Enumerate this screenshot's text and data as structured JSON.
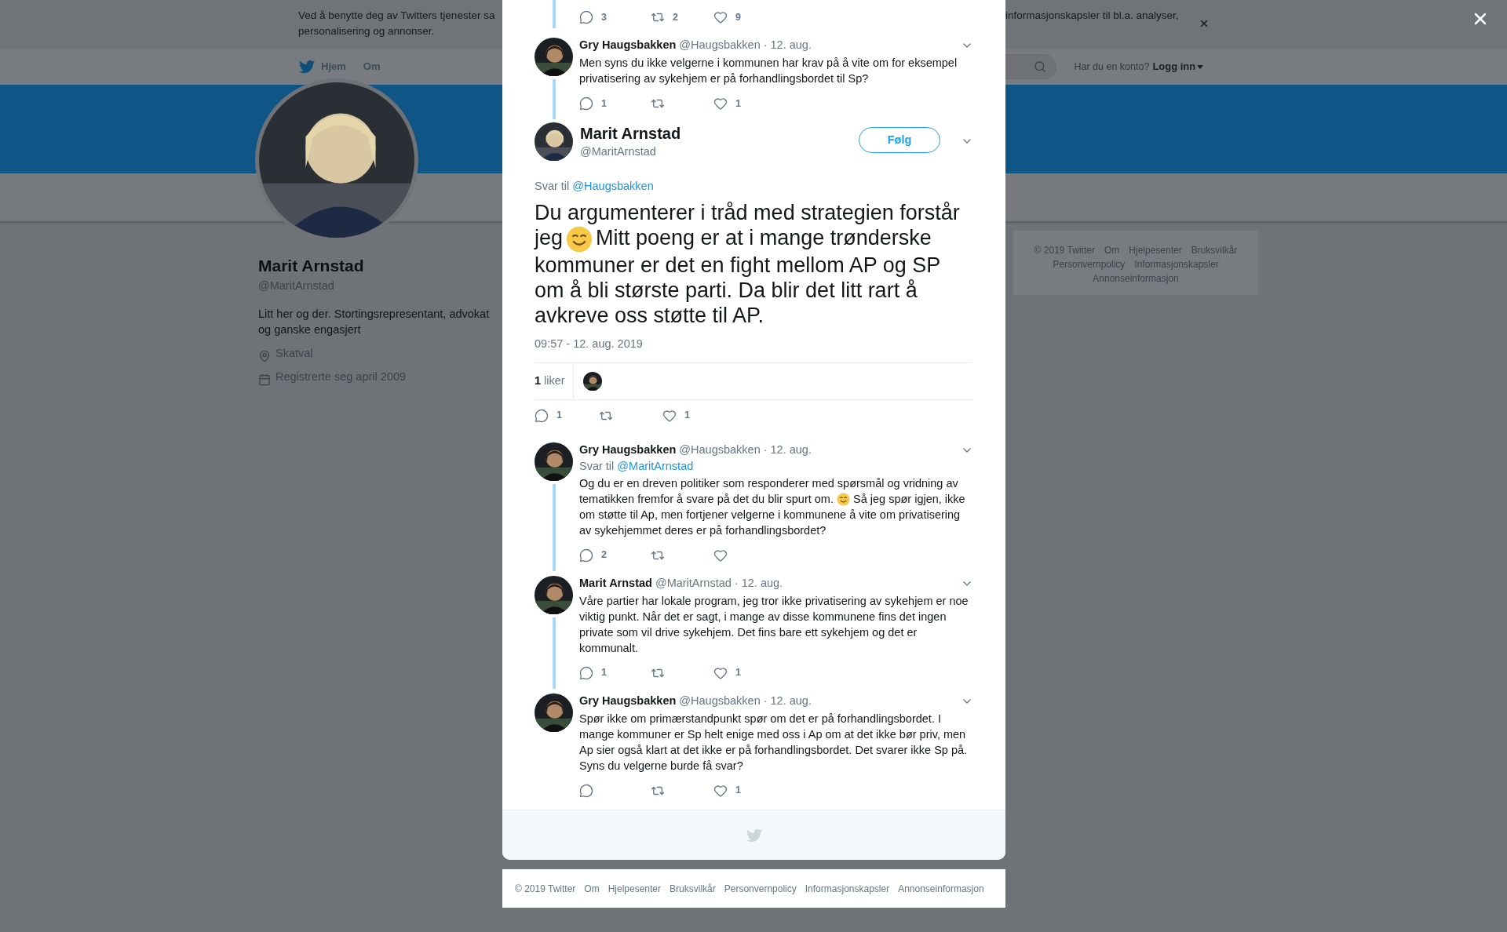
{
  "cookie_banner": {
    "lines": [
      "Ved å benytte deg av Twitters tjenester sa",
      "personalisering og annonser."
    ],
    "continuation": "informasjonskapsler til bl.a. analyser,"
  },
  "nav": {
    "items": [
      {
        "label": "Hjem",
        "kind": "home"
      },
      {
        "label": "Om",
        "kind": "link"
      }
    ],
    "account_prompt": "Har du en konto?",
    "login": "Logg inn"
  },
  "profile": {
    "name": "Marit Arnstad",
    "handle": "@MaritArnstad",
    "bio": "Litt her og der. Stortingsrepresentant, advokat og ganske engasjert",
    "location": "Skatval",
    "joined": "Registrerte seg april 2009"
  },
  "side_footer": {
    "links": [
      "© 2019 Twitter",
      "Om",
      "Hjelpesenter",
      "Bruksvilkår",
      "Personvernpolicy",
      "Informasjonskapsler",
      "Annonseinformasjon"
    ]
  },
  "dialog": {
    "thread": [
      {
        "kind": "actions",
        "threaded": true,
        "actions": {
          "replies": "3",
          "retweets": "2",
          "likes": "9"
        }
      },
      {
        "kind": "reply",
        "name": "Gry Haugsbakken",
        "handle": "@Haugsbakken",
        "date": "· 12. aug.",
        "text": [
          "Men syns du ikke velgerne i kommunen har krav på å vite om for eksempel privatisering av sykehjem er på forhandlingsbordet til Sp?"
        ],
        "actions": {
          "replies": "1",
          "likes": "1"
        },
        "threaded": true
      },
      {
        "kind": "main",
        "name": "Marit Arnstad",
        "handle": "@MaritArnstad",
        "follow": "Følg",
        "reply_to": {
          "label": "Svar til",
          "user": "@Haugsbakken"
        },
        "text": [
          "Du argumenterer i tråd med strategien forstår jeg",
          "Mitt poeng er at i mange trønderske kommuner er det en fight mellom AP og SP om å bli største parti. Da blir det litt rart å avkreve oss støtte til AP."
        ],
        "timestamp": "09:57 - 12. aug. 2019",
        "likes_count": "1",
        "likes_label": "liker",
        "actions": {
          "replies": "1",
          "likes": "1"
        },
        "threaded": false
      },
      {
        "kind": "reply",
        "name": "Gry Haugsbakken",
        "handle": "@Haugsbakken",
        "date": "· 12. aug.",
        "reply_to": {
          "label": "Svar til",
          "user": "@MaritArnstad"
        },
        "text": [
          "Og du er en dreven politiker som responderer med spørsmål og vridning av tematikken fremfor å svare på det du blir spurt om.",
          "Så jeg spør igjen, ikke om støtte til Ap, men fortjener velgerne i kommunene å vite om privatisering av sykehjemmet deres er på forhandlingsbordet?"
        ],
        "actions": {
          "replies": "2"
        },
        "threaded": true
      },
      {
        "kind": "reply",
        "name": "Marit Arnstad",
        "handle": "@MaritArnstad",
        "date": "· 12. aug.",
        "text": [
          "Våre partier har lokale program, jeg tror ikke privatisering av sykehjem er noe viktig punkt. Når det er sagt, i mange av disse kommunene fins det ingen private som vil drive sykehjem. Det fins bare ett sykehjem og det er kommunalt."
        ],
        "actions": {
          "replies": "1",
          "likes": "1"
        },
        "threaded": true
      },
      {
        "kind": "reply",
        "name": "Gry Haugsbakken",
        "handle": "@Haugsbakken",
        "date": "· 12. aug.",
        "text": [
          "Spør ikke om primærstandpunkt spør om det er på forhandlingsbordet. I mange kommuner er Sp helt enige med oss i Ap om at det ikke bør priv, men Ap sier også klart at det ikke er på forhandlingsbordet. Det svarer ikke Sp på. Syns du velgerne burde få svar?"
        ],
        "actions": {
          "likes": "1"
        },
        "threaded": false
      }
    ],
    "footer_links": [
      "© 2019 Twitter",
      "Om",
      "Hjelpesenter",
      "Bruksvilkår",
      "Personvernpolicy",
      "Informasjonskapsler",
      "Annonseinformasjon"
    ]
  }
}
